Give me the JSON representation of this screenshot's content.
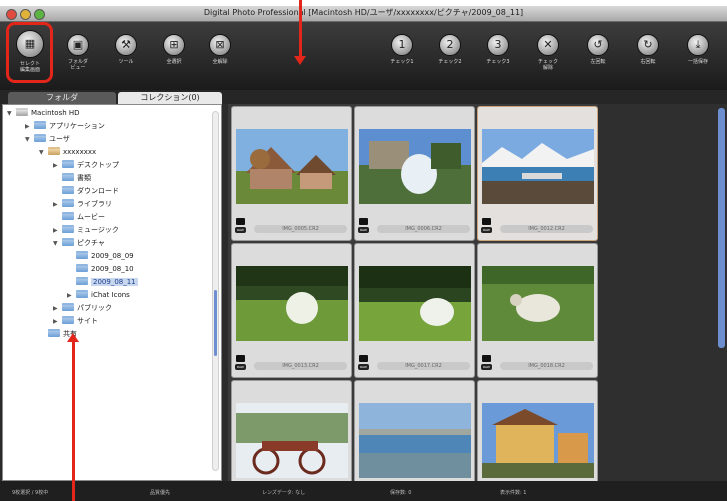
{
  "window": {
    "title": "Digital Photo Professional [Macintosh HD/ユーザ/xxxxxxxx/ピクチャ/2009_08_11]"
  },
  "toolbar": {
    "left": [
      {
        "label": "セレクト\n編集画面",
        "icon": "select-edit-icon"
      },
      {
        "label": "フォルダ\nビュー",
        "icon": "folder-view-icon"
      },
      {
        "label": "ツール",
        "icon": "tool-icon"
      },
      {
        "label": "全選択",
        "icon": "select-all-icon"
      },
      {
        "label": "全解除",
        "icon": "deselect-all-icon"
      }
    ],
    "right": [
      {
        "label": "チェック1",
        "icon": "check1-icon"
      },
      {
        "label": "チェック2",
        "icon": "check2-icon"
      },
      {
        "label": "チェック3",
        "icon": "check3-icon"
      },
      {
        "label": "チェック\n解除",
        "icon": "check-clear-icon"
      },
      {
        "label": "左回転",
        "icon": "rotate-left-icon"
      },
      {
        "label": "右回転",
        "icon": "rotate-right-icon"
      },
      {
        "label": "一括保存",
        "icon": "batch-save-icon"
      }
    ]
  },
  "tabs": {
    "folder": "フォルダ",
    "collection": "コレクション(0)"
  },
  "tree": [
    "Macintosh HD",
    "アプリケーション",
    "ユーザ",
    "xxxxxxxx",
    "デスクトップ",
    "書類",
    "ダウンロード",
    "ライブラリ",
    "ムービー",
    "ミュージック",
    "ピクチャ",
    "2009_08_09",
    "2009_08_10",
    "2009_08_11",
    "iChat Icons",
    "パブリック",
    "サイト",
    "共有"
  ],
  "photos": [
    {
      "name": "IMG_0005.CR2"
    },
    {
      "name": "IMG_0006.CR2"
    },
    {
      "name": "IMG_0012.CR2"
    },
    {
      "name": "IMG_0013.CR2"
    },
    {
      "name": "IMG_0017.CR2"
    },
    {
      "name": "IMG_0018.CR2"
    },
    {
      "name": ""
    },
    {
      "name": ""
    },
    {
      "name": ""
    }
  ],
  "status": {
    "count": "9枚選択 / 9枚中",
    "selection": "品質優先",
    "lens": "レンズデータ: なし",
    "saved": "保存数: 0",
    "checked": "表示件数: 1"
  },
  "colors": {
    "highlight": "#e3261a",
    "accent": "#6d8fd0"
  }
}
